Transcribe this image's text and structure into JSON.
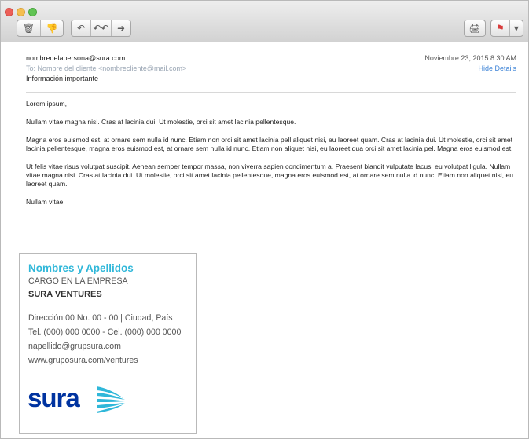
{
  "toolbar": {
    "buttons": {
      "delete": "🗑",
      "junk": "👎",
      "reply": "↶",
      "reply_all": "↶↶",
      "forward": "➜",
      "print": "🖨",
      "flag": "⚑",
      "flag_menu": "▾"
    }
  },
  "message": {
    "from": "nombredelapersona@sura.com",
    "to": "To: Nombre del cliente <nombrecliente@mail.com>",
    "subject": "Información importante",
    "date": "Noviembre 23, 2015 8:30 AM",
    "hide_details": "Hide Details",
    "paragraphs": [
      "Lorem ipsum,",
      "Nullam vitae magna nisi. Cras at lacinia dui. Ut molestie, orci sit amet lacinia pellentesque.",
      "Magna eros euismod est, at ornare sem nulla id nunc. Etiam non orci sit amet lacinia pell aliquet nisi, eu laoreet quam. Cras at lacinia dui. Ut molestie, orci sit amet lacinia pellentesque, magna eros euismod est, at ornare sem nulla id nunc. Etiam non aliquet nisi, eu laoreet qua orci sit amet lacinia pel. Magna eros euismod est,",
      "Ut felis vitae risus volutpat suscipit. Aenean semper tempor massa, non viverra sapien condimentum a. Praesent blandit vulputate lacus, eu volutpat ligula. Nullam vitae magna nisi. Cras at lacinia dui. Ut molestie, orci sit amet lacinia pellentesque, magna eros euismod est, at ornare sem nulla id nunc. Etiam non aliquet nisi, eu laoreet quam.",
      "Nullam vitae,"
    ]
  },
  "signature": {
    "name": "Nombres y Apellidos",
    "title": "CARGO EN LA EMPRESA",
    "company": "SURA VENTURES",
    "address": "Dirección 00 No. 00 - 00 | Ciudad, País",
    "phone": "Tel. (000) 000 0000 - Cel. (000) 000 0000",
    "email": "napellido@grupsura.com",
    "web": "www.gruposura.com/ventures",
    "logo_text": "sura",
    "brand_color": "#0033a0",
    "accent_color": "#2fb7d9"
  }
}
